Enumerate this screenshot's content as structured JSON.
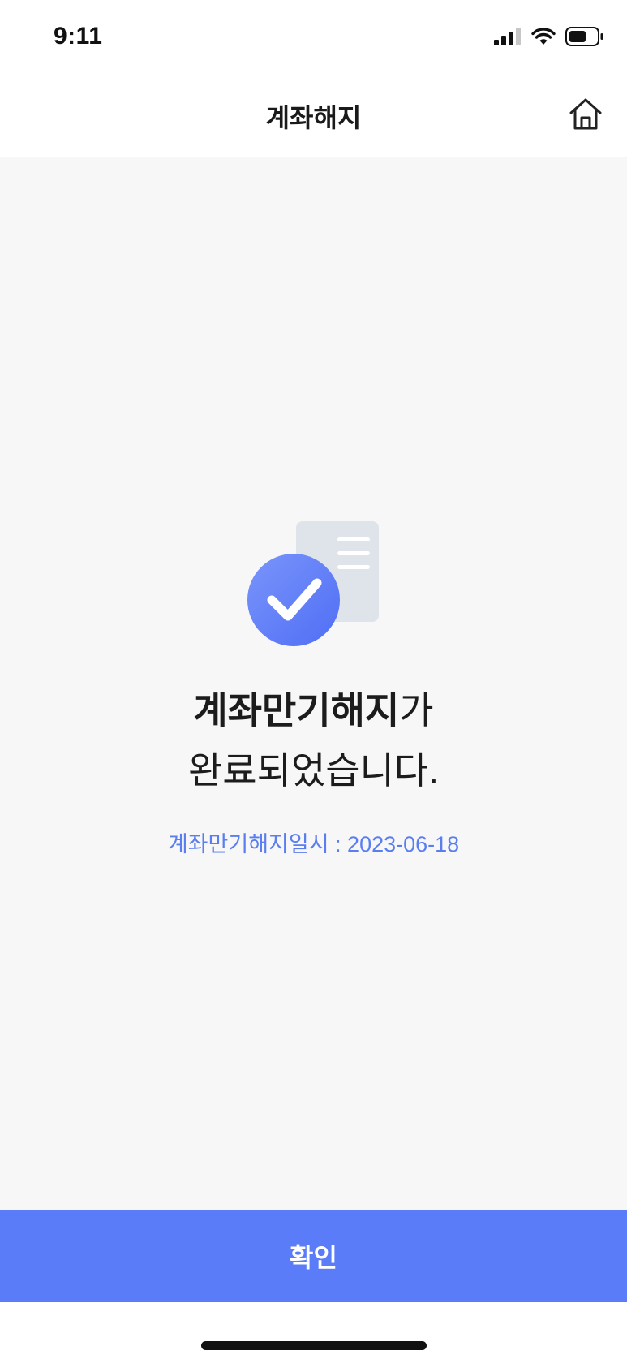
{
  "status_bar": {
    "time": "9:11",
    "icons": [
      "signal-icon",
      "wifi-icon",
      "battery-icon"
    ]
  },
  "header": {
    "title": "계좌해지",
    "home_icon": "home-icon"
  },
  "result": {
    "illustration_icon": "check-document-icon",
    "message_strong": "계좌만기해지",
    "message_rest_line1": "가",
    "message_line2": "완료되었습니다.",
    "datetime_text": "계좌만기해지일시 : 2023-06-18"
  },
  "footer": {
    "confirm_label": "확인"
  },
  "colors": {
    "accent": "#5b7cf8",
    "datetime_text": "#5a7ef0",
    "content_background": "#f7f7f8"
  }
}
